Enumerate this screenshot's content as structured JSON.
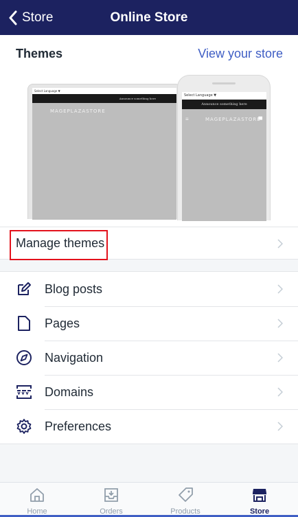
{
  "nav": {
    "back_label": "Store",
    "title": "Online Store",
    "background": "#1c2260"
  },
  "themes": {
    "label": "Themes",
    "view_store_link": "View your store",
    "preview": {
      "desktop_language": "Select Language ▼",
      "desktop_announcement": "Announce something here",
      "desktop_brand": "MAGEPLAZASTORE",
      "phone_language": "Select Language ▼",
      "phone_announcement": "Announce something here",
      "phone_brand": "MAGEPLAZASTORE"
    }
  },
  "manage_themes": {
    "label": "Manage themes",
    "highlight_color": "#e3111b"
  },
  "menu_items": [
    {
      "label": "Blog posts",
      "icon": "edit-icon"
    },
    {
      "label": "Pages",
      "icon": "page-icon"
    },
    {
      "label": "Navigation",
      "icon": "compass-icon"
    },
    {
      "label": "Domains",
      "icon": "domains-icon"
    },
    {
      "label": "Preferences",
      "icon": "gear-icon"
    }
  ],
  "tabbar": {
    "tabs": [
      {
        "label": "Home",
        "icon": "home-icon",
        "active": false
      },
      {
        "label": "Orders",
        "icon": "orders-icon",
        "active": false
      },
      {
        "label": "Products",
        "icon": "tag-icon",
        "active": false
      },
      {
        "label": "Store",
        "icon": "store-icon",
        "active": true
      }
    ]
  },
  "colors": {
    "accent": "#3f5ec4",
    "icon_color": "#1c2260",
    "chevron": "#c4cdd5"
  }
}
